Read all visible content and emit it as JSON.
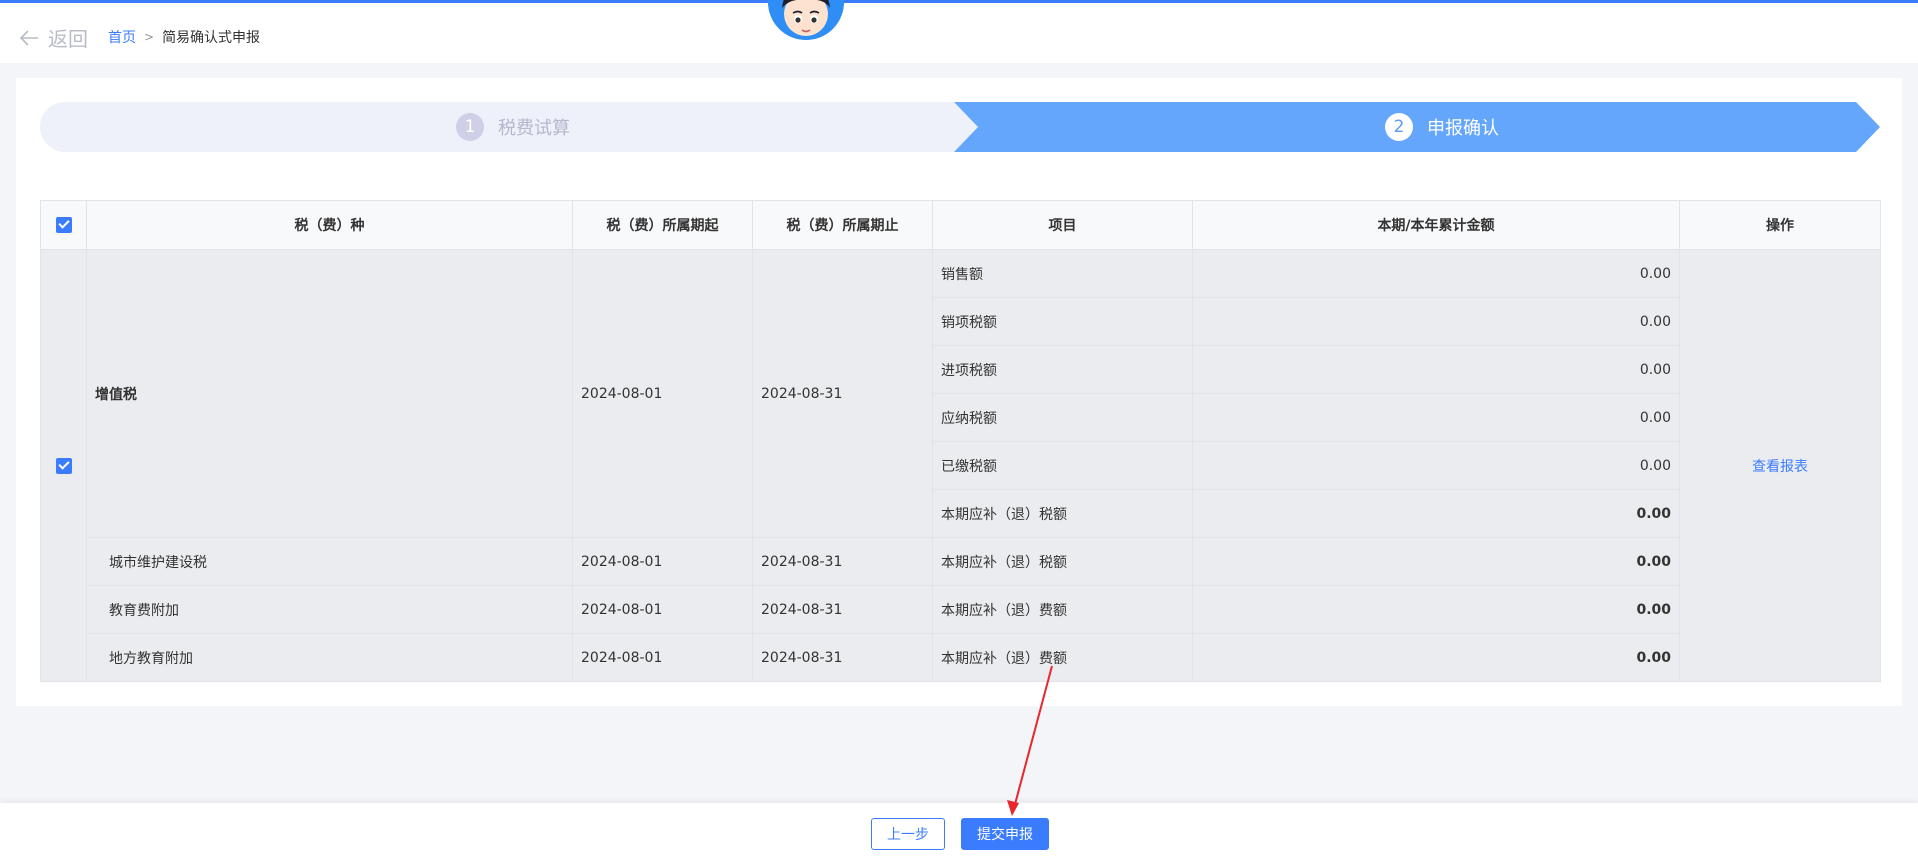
{
  "header": {
    "back_label": "返回",
    "breadcrumb": {
      "home": "首页",
      "separator": ">",
      "current": "简易确认式申报"
    }
  },
  "steps": [
    {
      "num": "1",
      "label": "税费试算",
      "state": "done"
    },
    {
      "num": "2",
      "label": "申报确认",
      "state": "active"
    }
  ],
  "table": {
    "columns": [
      "税（费）种",
      "税（费）所属期起",
      "税（费）所属期止",
      "项目",
      "本期/本年累计金额",
      "操作"
    ],
    "vat": {
      "name": "增值税",
      "start": "2024-08-01",
      "end": "2024-08-31",
      "items": [
        {
          "label": "销售额",
          "amount": "0.00"
        },
        {
          "label": "销项税额",
          "amount": "0.00"
        },
        {
          "label": "进项税额",
          "amount": "0.00"
        },
        {
          "label": "应纳税额",
          "amount": "0.00"
        },
        {
          "label": "已缴税额",
          "amount": "0.00"
        },
        {
          "label": "本期应补（退）税额",
          "amount": "0.00"
        }
      ]
    },
    "others": [
      {
        "name": "城市维护建设税",
        "start": "2024-08-01",
        "end": "2024-08-31",
        "item": "本期应补（退）税额",
        "amount": "0.00"
      },
      {
        "name": "教育费附加",
        "start": "2024-08-01",
        "end": "2024-08-31",
        "item": "本期应补（退）费额",
        "amount": "0.00"
      },
      {
        "name": "地方教育附加",
        "start": "2024-08-01",
        "end": "2024-08-31",
        "item": "本期应补（退）费额",
        "amount": "0.00"
      }
    ],
    "action_label": "查看报表"
  },
  "footer": {
    "prev_label": "上一步",
    "submit_label": "提交申报"
  },
  "colors": {
    "accent": "#3b7cff",
    "step_active": "#64a6fb",
    "step_inactive": "#eef0fa",
    "arrow": "#e8262b"
  }
}
